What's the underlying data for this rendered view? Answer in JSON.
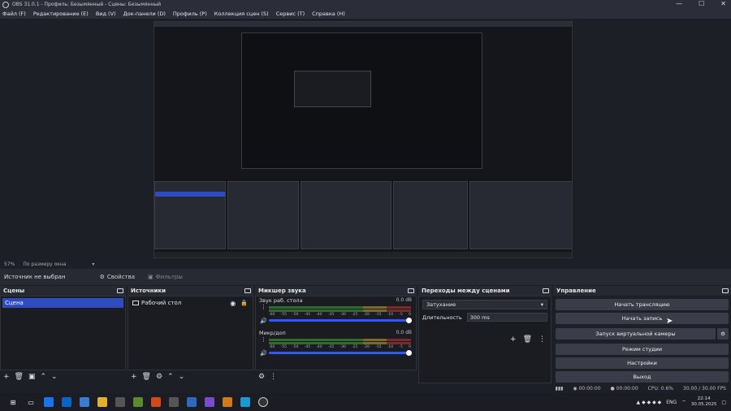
{
  "window": {
    "title": "OBS 31.0.1 - Профиль: Безымянный - Сцены: Безымянный",
    "min": "—",
    "max": "☐",
    "close": "✕"
  },
  "menu": [
    "Файл (F)",
    "Редактирование (E)",
    "Вид (V)",
    "Док-панели (D)",
    "Профиль (P)",
    "Коллекция сцен (S)",
    "Сервис (T)",
    "Справка (H)"
  ],
  "zoom": {
    "percent": "57%",
    "mode": "По размеру окна"
  },
  "source_toolbar": {
    "no_source": "Источник не выбран",
    "properties": "Свойства",
    "filters": "Фильтры"
  },
  "scenes": {
    "title": "Сцены",
    "items": [
      "Сцена"
    ]
  },
  "sources": {
    "title": "Источники",
    "items": [
      "Рабочий стол"
    ]
  },
  "mixer": {
    "title": "Микшер звука",
    "channels": [
      {
        "name": "Звук раб. стола",
        "db": "0.0 dB"
      },
      {
        "name": "Микр/доп",
        "db": "0.0 dB"
      }
    ],
    "ticks": [
      "-60",
      "-55",
      "-50",
      "-45",
      "-40",
      "-35",
      "-30",
      "-25",
      "-20",
      "-15",
      "-10",
      "-5",
      "0"
    ]
  },
  "transitions": {
    "title": "Переходы между сценами",
    "type": "Затухание",
    "duration_label": "Длительность",
    "duration": "300 ms"
  },
  "controls": {
    "title": "Управление",
    "buttons": [
      "Начать трансляцию",
      "Начать запись",
      "Запуск виртуальной камеры",
      "Режим студии",
      "Настройки",
      "Выход"
    ]
  },
  "status": {
    "rec_time": "00:00:00",
    "stream_time": "00:00:00",
    "cpu": "CPU: 0.6%",
    "fps": "30.00 / 30.00 FPS"
  },
  "tray": {
    "lang": "ENG",
    "time": "22:14",
    "date": "30.05.2025"
  },
  "colors": {
    "selected": "#2f4bbf",
    "volume": "#3355ff"
  }
}
